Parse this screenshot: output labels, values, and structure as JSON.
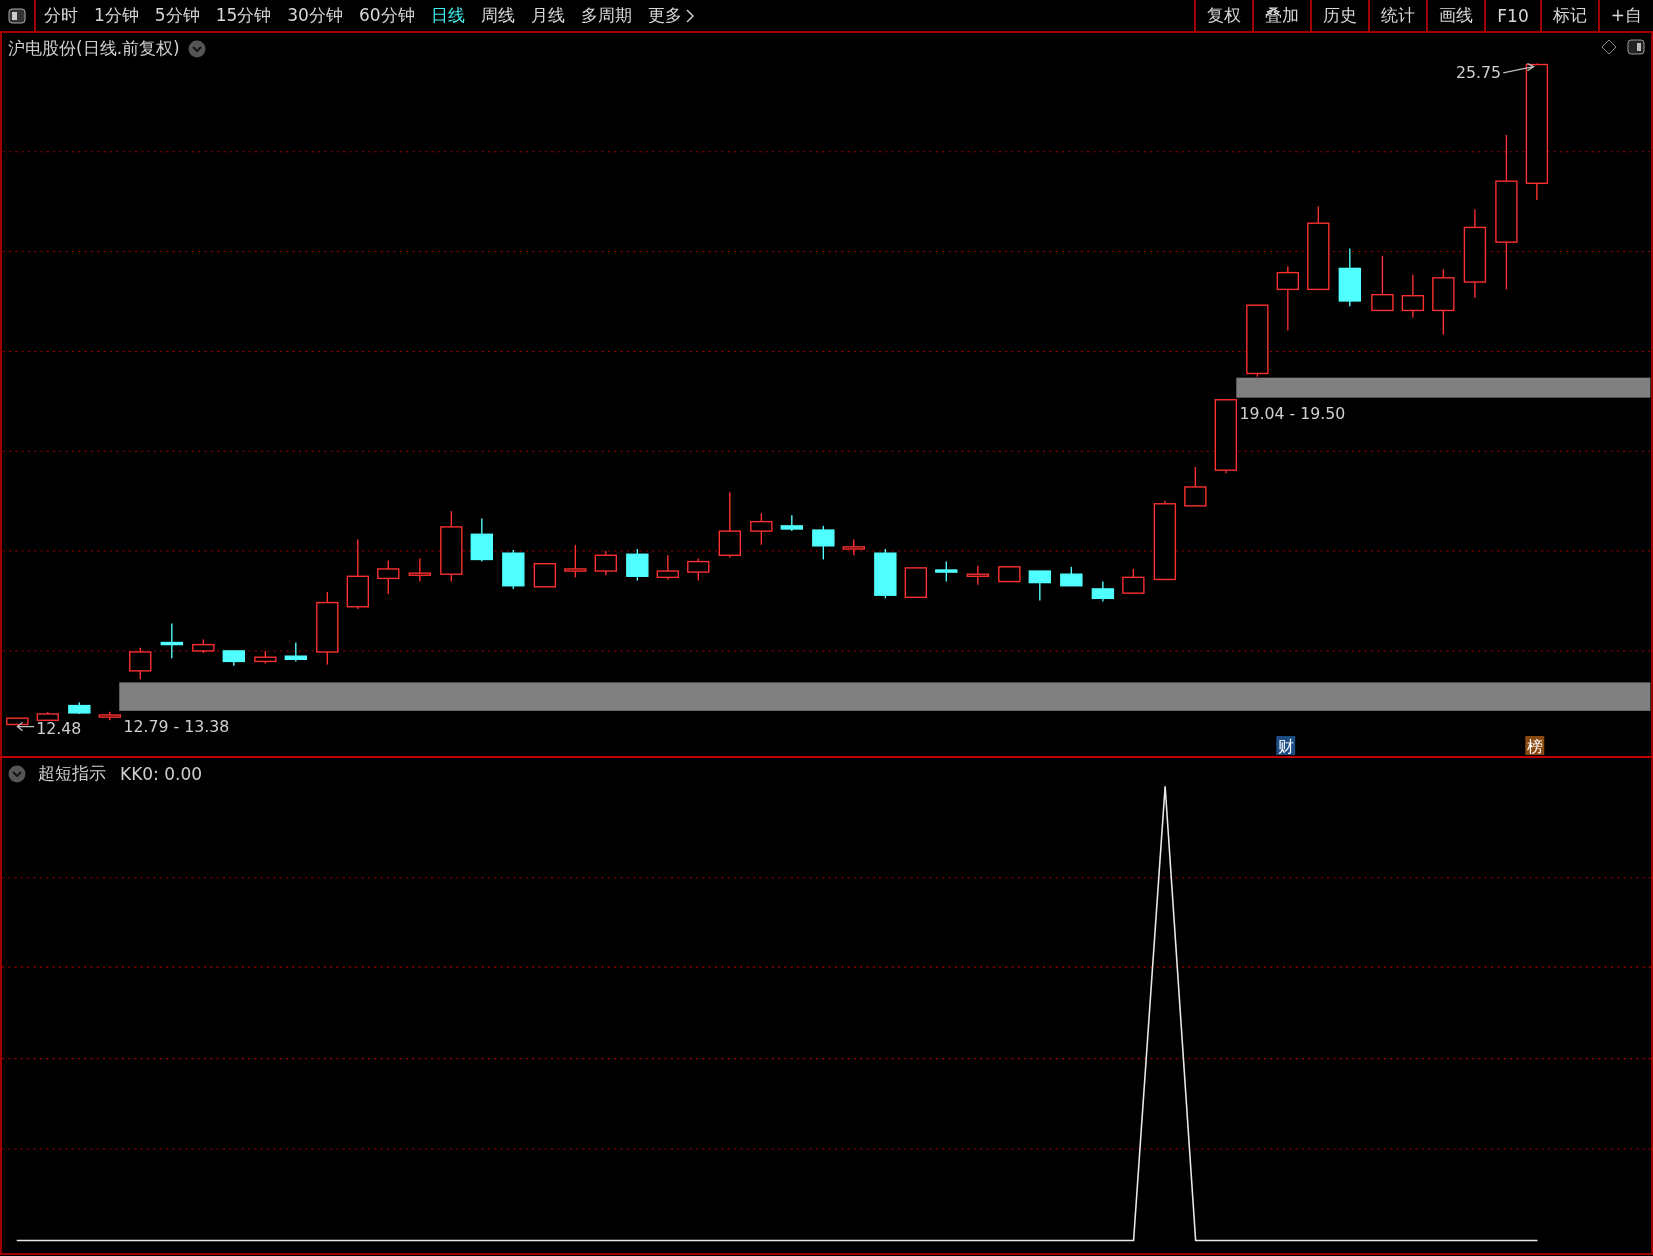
{
  "toolbar": {
    "tabs": [
      {
        "label": "分时",
        "selected": false
      },
      {
        "label": "1分钟",
        "selected": false
      },
      {
        "label": "5分钟",
        "selected": false
      },
      {
        "label": "15分钟",
        "selected": false
      },
      {
        "label": "30分钟",
        "selected": false
      },
      {
        "label": "60分钟",
        "selected": false
      },
      {
        "label": "日线",
        "selected": true
      },
      {
        "label": "周线",
        "selected": false
      },
      {
        "label": "月线",
        "selected": false
      },
      {
        "label": "多周期",
        "selected": false
      }
    ],
    "more": "更多",
    "buttons": [
      "复权",
      "叠加",
      "历史",
      "统计",
      "画线",
      "F10",
      "标记",
      "+自"
    ]
  },
  "chart": {
    "title": "沪电股份(日线.前复权)",
    "high_label": "25.75",
    "low_label": "12.48",
    "zones": [
      {
        "range": "12.79 - 13.38"
      },
      {
        "range": "19.04 - 19.50"
      }
    ],
    "markers": [
      {
        "text": "财",
        "color": "#1d4e86"
      },
      {
        "text": "榜",
        "color": "#8a4a12"
      }
    ]
  },
  "indicator": {
    "name": "超短指示",
    "reading": "KK0: 0.00"
  }
}
